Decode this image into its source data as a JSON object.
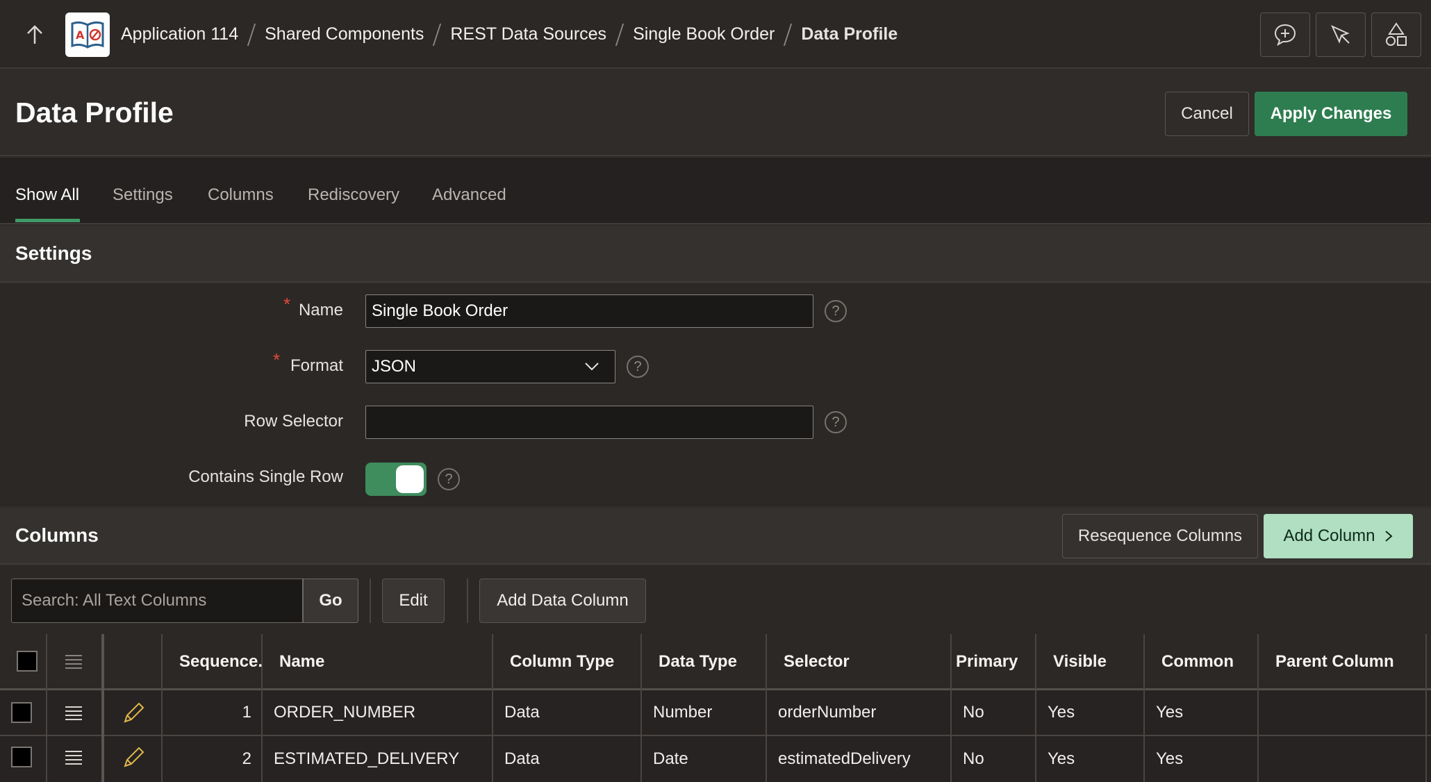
{
  "breadcrumb": {
    "items": [
      "Application 114",
      "Shared Components",
      "REST Data Sources",
      "Single Book Order"
    ],
    "current": "Data Profile"
  },
  "page": {
    "title": "Data Profile",
    "cancel_label": "Cancel",
    "apply_label": "Apply Changes"
  },
  "tabs": [
    "Show All",
    "Settings",
    "Columns",
    "Rediscovery",
    "Advanced"
  ],
  "settings": {
    "title": "Settings",
    "name_label": "Name",
    "name_value": "Single Book Order",
    "format_label": "Format",
    "format_value": "JSON",
    "row_selector_label": "Row Selector",
    "row_selector_value": "",
    "single_row_label": "Contains Single Row",
    "single_row_on": true,
    "required_mark": "*",
    "help_glyph": "?"
  },
  "columns": {
    "title": "Columns",
    "resequence_label": "Resequence Columns",
    "add_column_label": "Add Column",
    "search_placeholder": "Search: All Text Columns",
    "go_label": "Go",
    "edit_label": "Edit",
    "add_data_column_label": "Add Data Column",
    "headers": [
      "Sequence.",
      "Name",
      "Column Type",
      "Data Type",
      "Selector",
      "Primary",
      "Visible",
      "Common",
      "Parent Column"
    ],
    "rows": [
      {
        "seq": "1",
        "name": "ORDER_NUMBER",
        "column_type": "Data",
        "data_type": "Number",
        "selector": "orderNumber",
        "primary": "No",
        "visible": "Yes",
        "common": "Yes",
        "parent": ""
      },
      {
        "seq": "2",
        "name": "ESTIMATED_DELIVERY",
        "column_type": "Data",
        "data_type": "Date",
        "selector": "estimatedDelivery",
        "primary": "No",
        "visible": "Yes",
        "common": "Yes",
        "parent": ""
      }
    ]
  },
  "colors": {
    "primary_green": "#2e7d50",
    "hot_green": "#b0dfc1",
    "tab_accent": "#3f9a68",
    "required": "#e5493a"
  }
}
